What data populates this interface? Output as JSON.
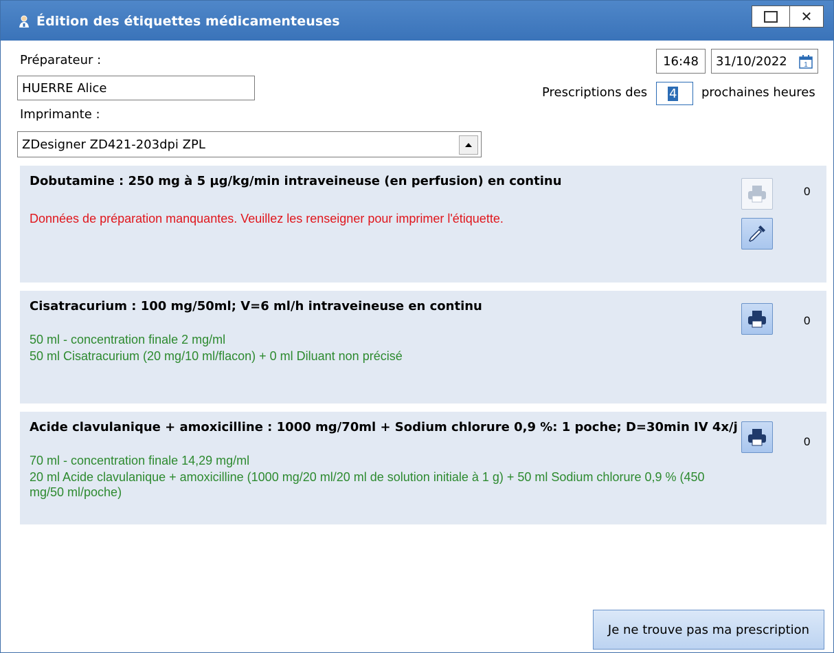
{
  "window": {
    "title": "Édition des étiquettes médicamenteuses",
    "title_icon": "pharmacist-icon",
    "maximize_icon": "maximize-icon",
    "close_icon": "close-icon",
    "close_glyph": "✕"
  },
  "form": {
    "preparer_label": "Préparateur :",
    "preparer_value": "HUERRE Alice",
    "printer_label": "Imprimante :",
    "printer_value": "ZDesigner ZD421-203dpi ZPL",
    "time_value": "16:48",
    "date_value": "31/10/2022",
    "calendar_icon": "calendar-icon",
    "calendar_day": "1",
    "prescriptions_prefix": "Prescriptions des",
    "hours_value": "4",
    "prescriptions_suffix": "prochaines heures"
  },
  "prescriptions": [
    {
      "title": "Dobutamine  : 250 mg à 5 µg/kg/min intraveineuse (en perfusion)  en continu",
      "status": "error",
      "lines": [
        "Données de préparation manquantes. Veuillez les renseigner pour imprimer l'étiquette."
      ],
      "count": "0",
      "print_enabled": false,
      "has_dropper": true
    },
    {
      "title": "Cisatracurium  : 100 mg/50ml; V=6 ml/h intraveineuse  en continu",
      "status": "ok",
      "lines": [
        "50 ml - concentration finale 2 mg/ml",
        "50 ml Cisatracurium  (20 mg/10 ml/flacon) + 0 ml Diluant non précisé"
      ],
      "count": "0",
      "print_enabled": true,
      "has_dropper": false
    },
    {
      "title": "Acide clavulanique + amoxicilline  : 1000 mg/70ml + Sodium chlorure 0,9 %: 1 poche; D=30min IV 4x/j",
      "status": "ok",
      "lines": [
        "70 ml - concentration finale 14,29 mg/ml",
        "20 ml Acide clavulanique + amoxicilline  (1000 mg/20 ml/20 ml de solution initiale à 1 g) + 50 ml Sodium chlorure 0,9 % (450 mg/50 ml/poche)"
      ],
      "count": "0",
      "print_enabled": true,
      "has_dropper": false
    }
  ],
  "footer": {
    "not_found_button": "Je ne trouve pas ma prescription"
  },
  "colors": {
    "titlebar": "#3f78bf",
    "panel": "#e2e9f3",
    "error": "#e0161c",
    "ok": "#2d8a2f"
  }
}
